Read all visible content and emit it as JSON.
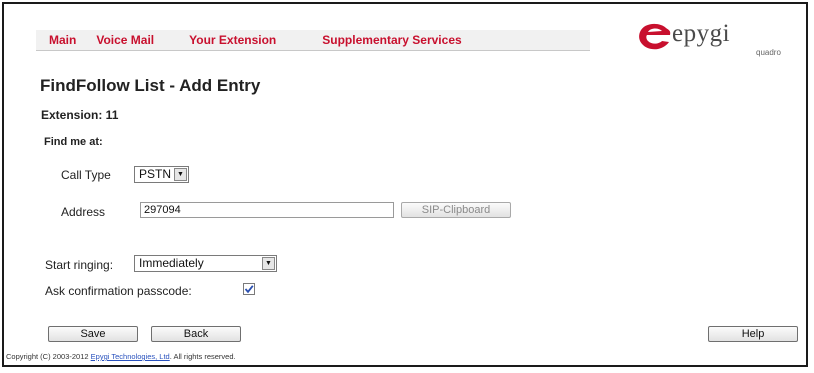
{
  "menu": {
    "items": [
      {
        "label": "Main"
      },
      {
        "label": "Voice Mail"
      },
      {
        "label": "Your Extension"
      },
      {
        "label": "Supplementary Services"
      }
    ]
  },
  "logo": {
    "text": "epygi",
    "subtext": "quadro"
  },
  "page_title": "FindFollow List - Add Entry",
  "extension_label": "Extension: 11",
  "find_me_label": "Find me at:",
  "call_type": {
    "label": "Call Type",
    "value": "PSTN"
  },
  "address": {
    "label": "Address",
    "value": "297094",
    "sip_button": "SIP-Clipboard"
  },
  "start_ringing": {
    "label": "Start ringing:",
    "value": "Immediately"
  },
  "confirmation": {
    "label": "Ask confirmation passcode:",
    "checked": true
  },
  "buttons": {
    "save": "Save",
    "back": "Back",
    "help": "Help"
  },
  "copyright": {
    "prefix": "Copyright (C) 2003-2012 ",
    "link": "Epygi Technologies, Ltd",
    "suffix": ". All rights reserved."
  },
  "colors": {
    "menu_text": "#c8102e",
    "logo_red": "#c8102e",
    "link": "#2a52be"
  }
}
